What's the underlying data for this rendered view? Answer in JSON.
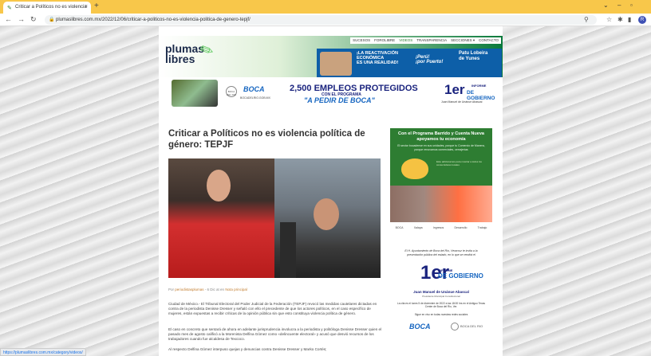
{
  "browser": {
    "tab_title": "Criticar a Políticos no es violencia",
    "tab_close": "×",
    "new_tab": "+",
    "url": "plumaslibres.com.mx/2022/12/06/criticar-a-politicos-no-es-violencia-politica-de-genero-tepjf/",
    "status_url": "https://plumaslibres.com.mx/category/videos/"
  },
  "site": {
    "nav": [
      "SUCESOS",
      "FOROLIBRE",
      "VIDEOS",
      "TRANSPARENCIA",
      "SECCIONES ▾",
      "CONTACTO"
    ],
    "logo_line1": "plumas",
    "logo_line2": "libres",
    "banner1": {
      "text1": "¡LA REACTIVACIÓN",
      "text2": "ECONÓMICA",
      "text3": "ES UNA REALIDAD!",
      "slogan1": "¡Perú!",
      "slogan2": "¡por Puerto!",
      "name1": "Patu Lobeira",
      "name2": "de Yunes"
    },
    "banner2": {
      "boca": "BOCA",
      "boca_url": "BOCADELRIO.GOB.MX",
      "seal": "BOCA DEL RIO",
      "emp_title": "2,500 EMPLEOS PROTEGIDOS",
      "emp_sub": "CON EL PROGRAMA",
      "emp_program": "\"A PEDIR DE BOCA\"",
      "inf_num": "1er",
      "inf_top": "INFORME",
      "inf_bottom": "DE GOBIERNO",
      "inf_name": "Juan Manuel de Unánue Abascal"
    }
  },
  "article": {
    "title": "Criticar a Políticos no es violencia política de género: TEPJF",
    "meta_prefix": "Por ",
    "meta_author": "periodistasplumas",
    "meta_date": " - 6 Dic at en ",
    "meta_category": "Nota principal",
    "p1": "Ciudad de México.- El Tribunal Electoral del Poder Judicial de la Federación (TEPJF) revocó las medidas cautelares dictadas en contra de la periodista Denisse Dresser y señaló con ello el precedente de que los actores políticos, en el caso específico de mujeres, están expuestas a recibir críticas de la opinión pública sin que esto constituya violencia política de género.",
    "p2": "El caso en concreto que sentará de ahora en adelante jurisprudencia involucra a la periodista y politóloga Denisse Dresser quien el pasado mes de agosto calificó a la Morenista Delfina Gómez como «delincuente electoral» y acusó que desvió recursos de los trabajadores cuando fue alcaldesa de Texcoco.",
    "p3": "Al respecto Delfina Gómez interpuso quejas y denuncias contra Denisse Dresser y Marko Cortés;"
  },
  "sidebar": {
    "ad1_title": "Con el Programa Barrido y Cuenta Nueva apoyamos tu economía",
    "ad1_sub": "El sector bocadense en sus unidades, porque tu Comercio de Manera, porque renovamos comerciales, cerrajerías",
    "ad1_text": "Este adicionamos para mostrar a todos los consumidores locales",
    "logos": [
      "BOCA",
      "Xalapa",
      "Ingresos",
      "Desarrollo",
      "Trabajo"
    ],
    "ad2_quote": "El H. Ayuntamiento de Boca del Río, Veracruz te invita a la presentación pública del estado, en lo que se rendirá el",
    "ad2_num": "1er",
    "ad2_inf1": "INFORME",
    "ad2_inf2": "DE GOBIERNO",
    "ad2_name": "Juan Manuel de Unánue Abascal",
    "ad2_role": "Presidente Municipal Constitucional",
    "ad2_date": "La cita es el lunes 5 de diciembre de 2022 a las 18:00 hrs en el Antiguo Texas Center de Boca del Río, Ver.",
    "ad2_follow": "Sigue en vivo en todas nuestras redes sociales",
    "ad2_boca": "BOCA",
    "ad2_boca_text": "BOCA DEL RIO"
  }
}
